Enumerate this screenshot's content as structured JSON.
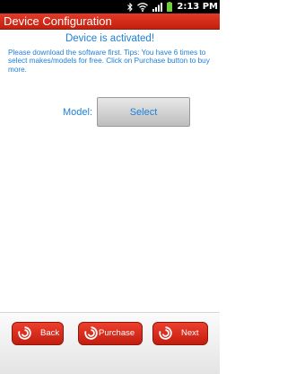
{
  "status_bar": {
    "time": "2:13 PM",
    "icons": [
      "bluetooth-icon",
      "wifi-icon",
      "signal-icon",
      "battery-icon"
    ]
  },
  "title": "Device Configuration",
  "headline": "Device is activated!",
  "info_text": "Please download the software first. Tips: You have 6 times to select makes/models for free. Click on Purchase button to buy more.",
  "model": {
    "label": "Model:",
    "select_label": "Select"
  },
  "bottom_nav": {
    "back_label": "Back",
    "purchase_label": "Purchase",
    "next_label": "Next",
    "icon": "swirl-logo-icon"
  },
  "colors": {
    "accent_red": "#d3301b",
    "text_blue": "#1e7fd8",
    "status_bar": "#000000",
    "battery_green": "#6fcf3f"
  }
}
